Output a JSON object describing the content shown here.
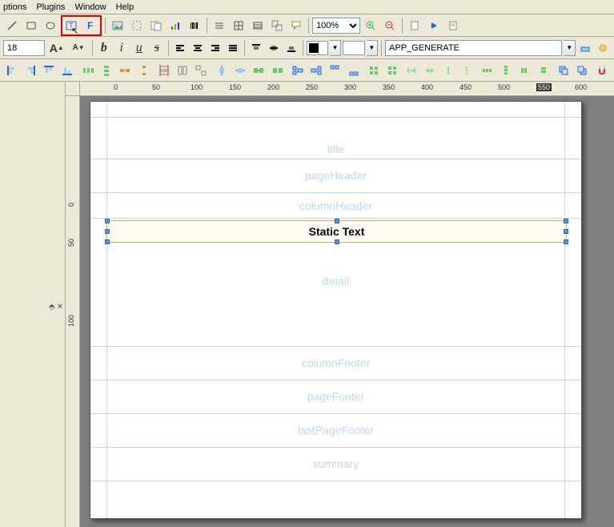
{
  "menu": {
    "options": "ptions",
    "plugins": "Plugins",
    "window": "Window",
    "help": "Help"
  },
  "toolbar1": {
    "zoom": "100%"
  },
  "toolbar2": {
    "fontSize": "18",
    "combo": "APP_GENERATE"
  },
  "ruler_h": [
    "0",
    "50",
    "100",
    "150",
    "200",
    "250",
    "300",
    "350",
    "400",
    "450",
    "500",
    "550",
    "600"
  ],
  "ruler_v": [
    "0",
    "50",
    "100"
  ],
  "bands": {
    "title": "title",
    "pageHeader": "pageHeader",
    "columnHeader": "columnHeader",
    "detail": "detail",
    "columnFooter": "columnFooter",
    "pageFooter": "pageFooter",
    "lastPageFooter": "lastPageFooter",
    "summary": "summary"
  },
  "element": {
    "staticText": "Static Text"
  },
  "sidepanel": {
    "pin": "⬘",
    "close": "✕"
  }
}
